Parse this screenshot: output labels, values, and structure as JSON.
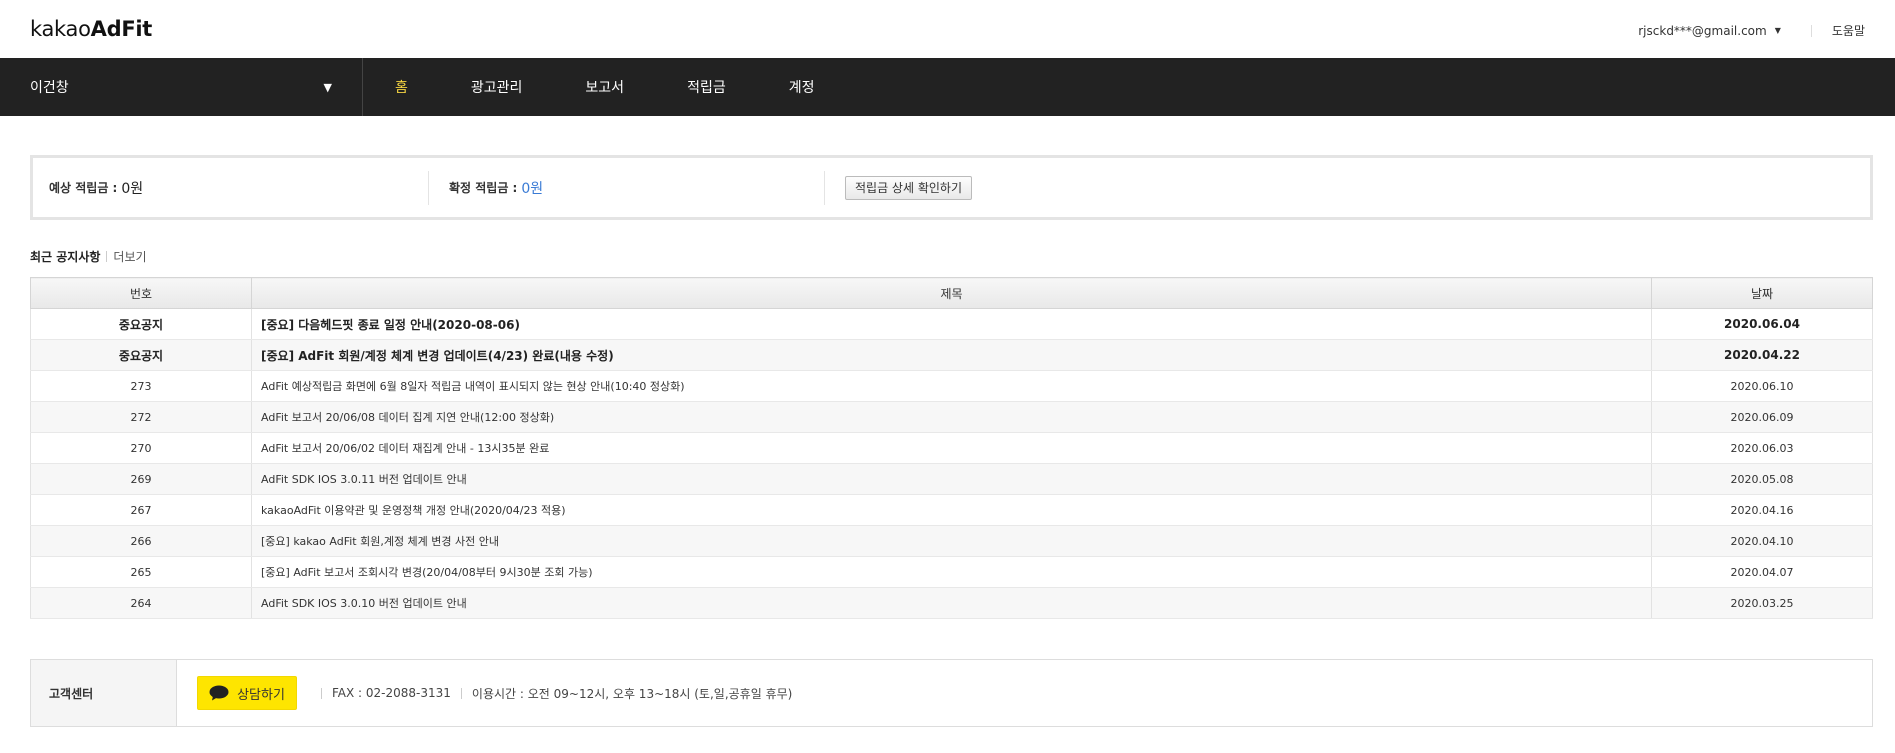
{
  "header": {
    "logo_prefix": "kakao",
    "logo_bold": "AdFit",
    "user_email": "rjsckd***@gmail.com",
    "help_label": "도움말"
  },
  "nav": {
    "site_name": "이건창",
    "items": [
      {
        "label": "홈",
        "active": true
      },
      {
        "label": "광고관리",
        "active": false
      },
      {
        "label": "보고서",
        "active": false
      },
      {
        "label": "적립금",
        "active": false
      },
      {
        "label": "계정",
        "active": false
      }
    ]
  },
  "summary": {
    "expected_label": "예상 적립금 :",
    "expected_value": "0원",
    "confirmed_label": "확정 적립금 :",
    "confirmed_value": "0원",
    "detail_button": "적립금 상세 확인하기"
  },
  "notices": {
    "title": "최근 공지사항",
    "more": "더보기",
    "columns": [
      "번호",
      "제목",
      "날짜"
    ],
    "rows": [
      {
        "no": "중요공지",
        "title": "[중요] 다음헤드핏 종료 일정 안내(2020-08-06)",
        "date": "2020.06.04",
        "important": true
      },
      {
        "no": "중요공지",
        "title": "[중요] AdFit 회원/계정 체계 변경 업데이트(4/23) 완료(내용 수정)",
        "date": "2020.04.22",
        "important": true
      },
      {
        "no": "273",
        "title": "AdFit 예상적립금 화면에 6월 8일자 적립금 내역이 표시되지 않는 현상 안내(10:40 정상화)",
        "date": "2020.06.10",
        "important": false
      },
      {
        "no": "272",
        "title": "AdFit 보고서 20/06/08 데이터 집계 지연 안내(12:00 정상화)",
        "date": "2020.06.09",
        "important": false
      },
      {
        "no": "270",
        "title": "AdFit 보고서 20/06/02 데이터 재집계 안내 - 13시35분 완료",
        "date": "2020.06.03",
        "important": false
      },
      {
        "no": "269",
        "title": "AdFit SDK IOS 3.0.11 버전 업데이트 안내",
        "date": "2020.05.08",
        "important": false
      },
      {
        "no": "267",
        "title": "kakaoAdFit 이용약관 및 운영정책 개정 안내(2020/04/23 적용)",
        "date": "2020.04.16",
        "important": false
      },
      {
        "no": "266",
        "title": "[중요] kakao AdFit 회원,계정 체계 변경 사전 안내",
        "date": "2020.04.10",
        "important": false
      },
      {
        "no": "265",
        "title": "[중요] AdFit 보고서 조회시각 변경(20/04/08부터 9시30분 조회 가능)",
        "date": "2020.04.07",
        "important": false
      },
      {
        "no": "264",
        "title": "AdFit SDK IOS 3.0.10 버전 업데이트 안내",
        "date": "2020.03.25",
        "important": false
      }
    ]
  },
  "customer_center": {
    "label": "고객센터",
    "chat_button": "상담하기",
    "fax": "FAX : 02-2088-3131",
    "hours": "이용시간 : 오전 09~12시, 오후 13~18시 (토,일,공휴일 휴무)"
  },
  "colors": {
    "nav_bg": "#222222",
    "nav_active": "#f5d442",
    "chat_yellow": "#fee500",
    "value_blue": "#3a7bd5"
  }
}
